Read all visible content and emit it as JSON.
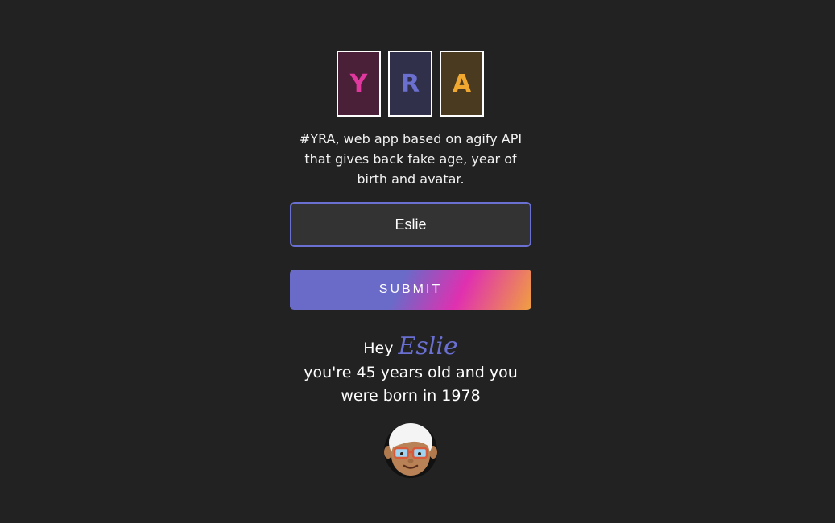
{
  "logo": {
    "letters": [
      "Y",
      "R",
      "A"
    ]
  },
  "tagline": "#YRA, web app based on agify API that gives back fake age, year of birth and avatar.",
  "form": {
    "name_value": "Eslie",
    "submit_label": "SUBMIT"
  },
  "result": {
    "hey": "Hey",
    "name": "Eslie",
    "line1": "you're 45 years old and you",
    "line2": "were born in 1978"
  },
  "avatar_icon": "old-person-emoji",
  "colors": {
    "background": "#222222",
    "accent": "#6a6fd2",
    "pink": "#e0389e",
    "orange": "#f0a830"
  }
}
